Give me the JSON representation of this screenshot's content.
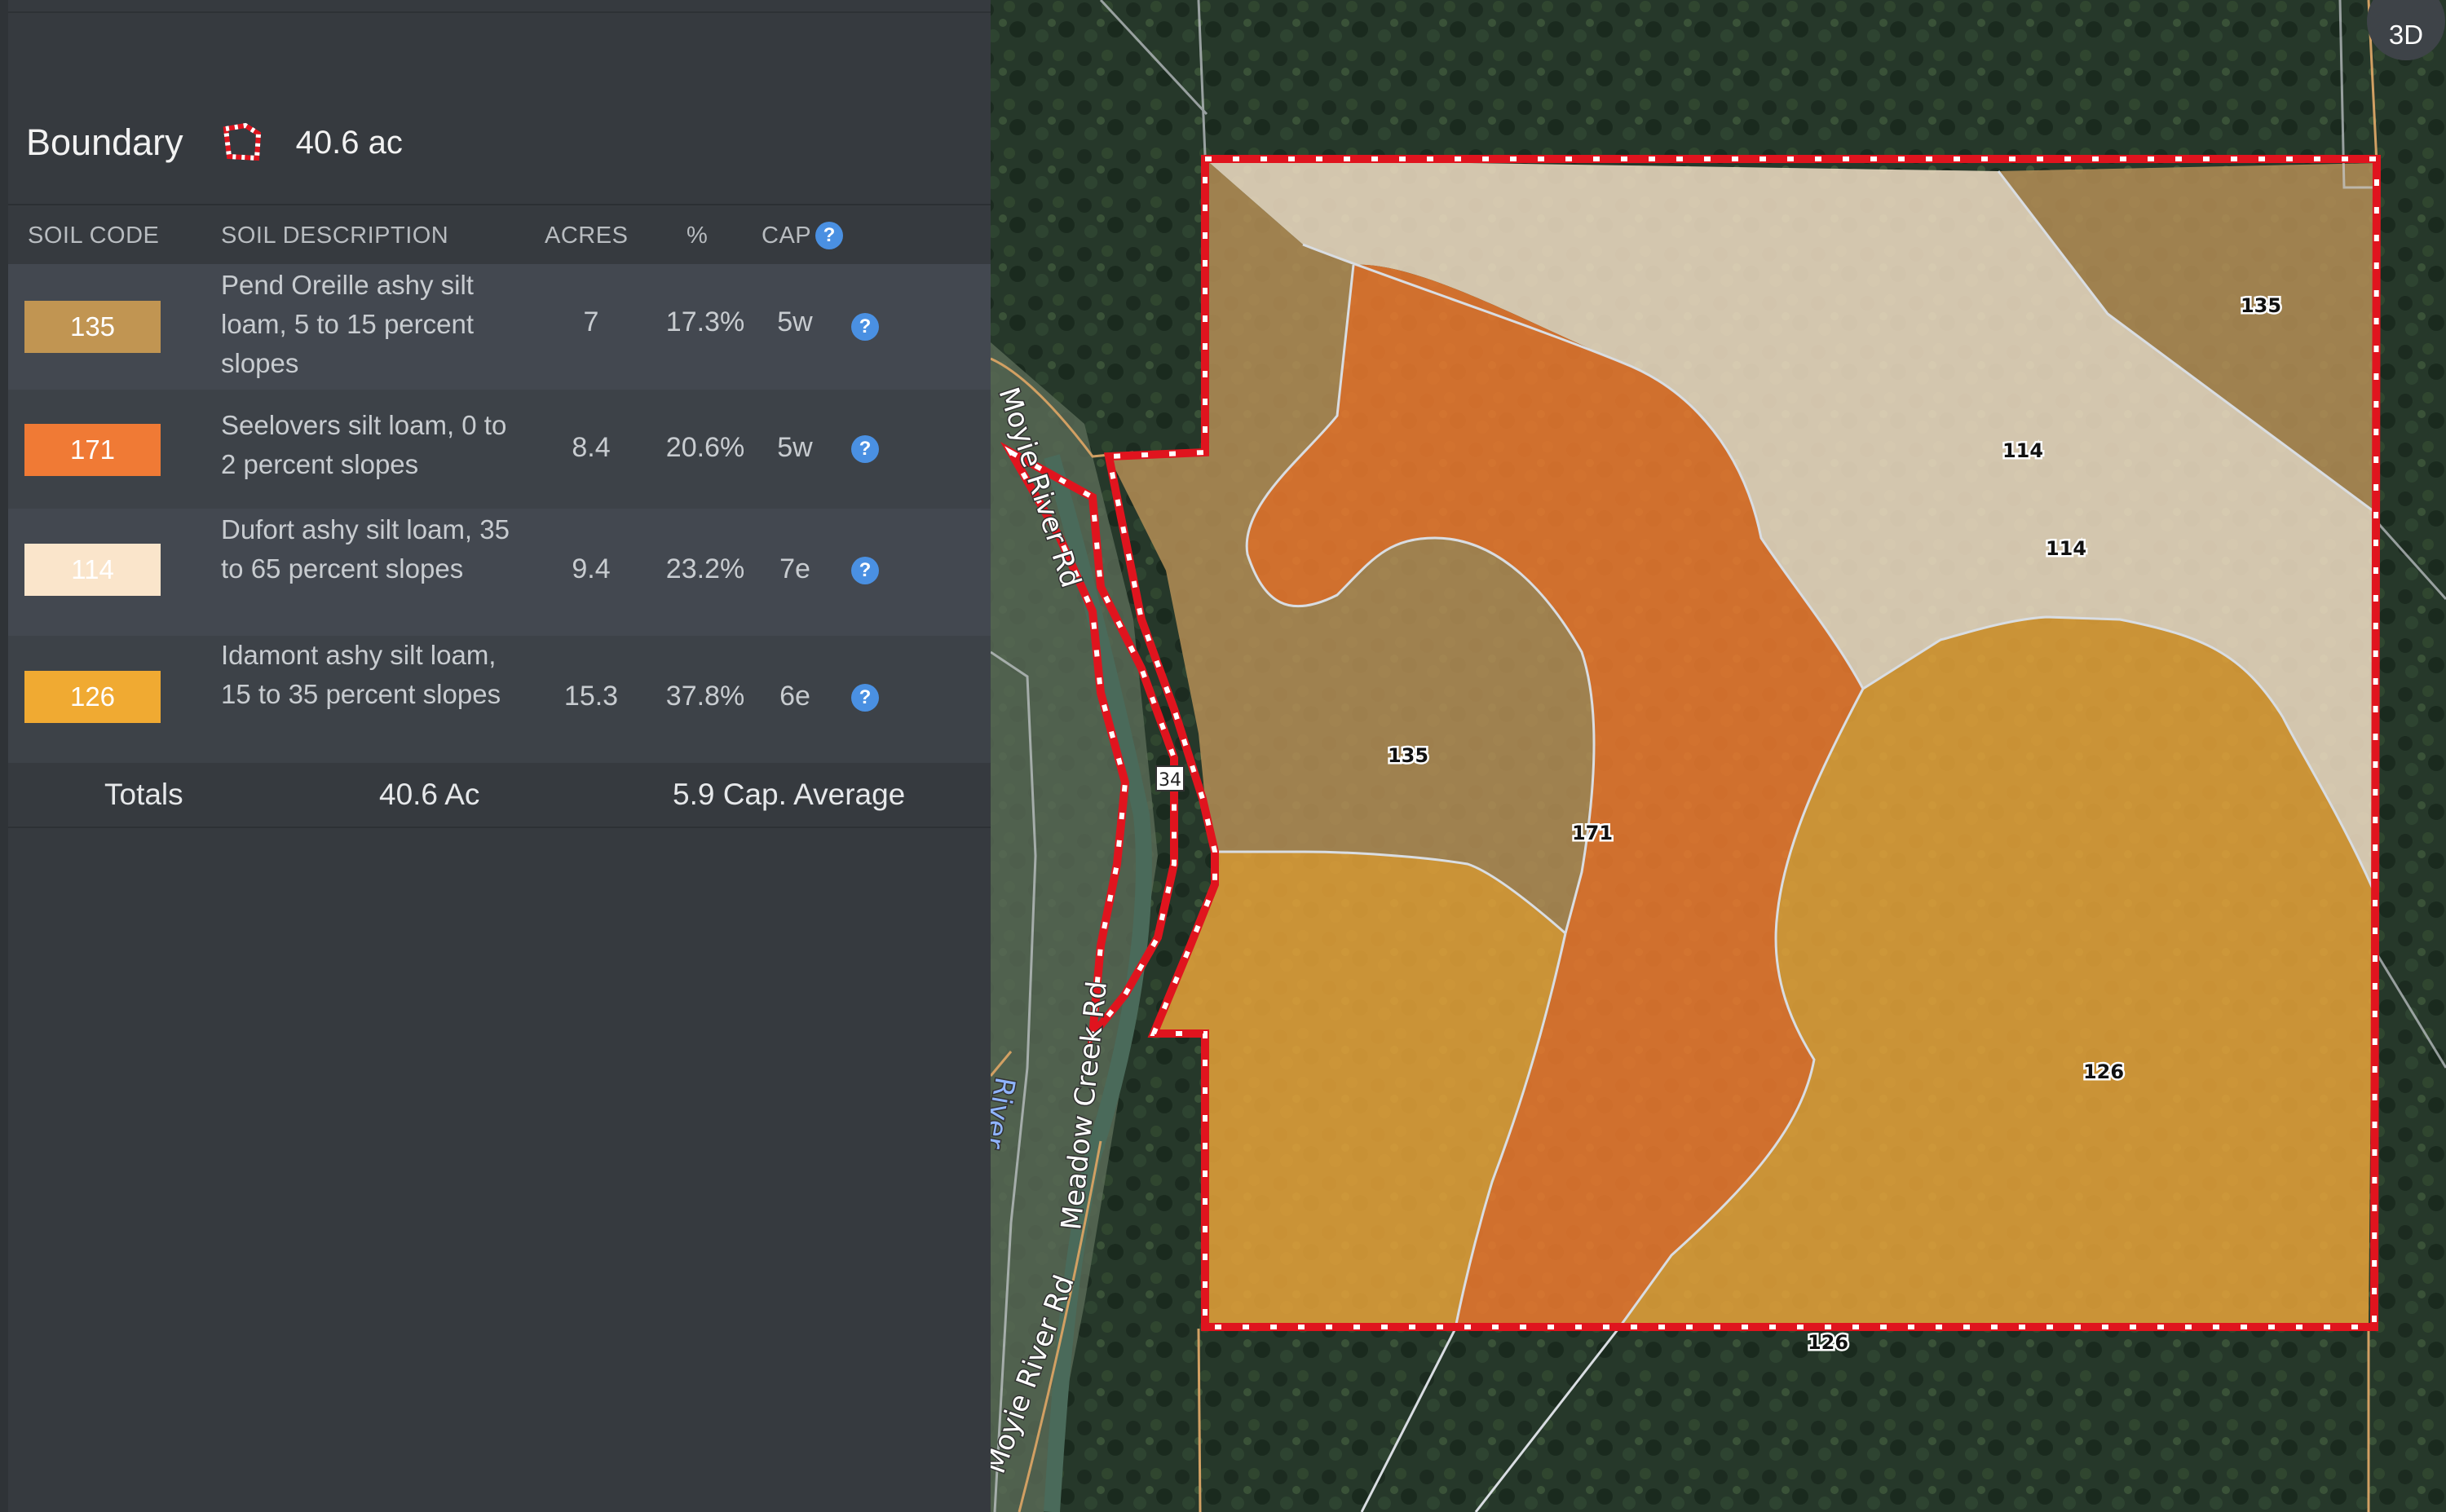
{
  "boundary": {
    "title": "Boundary",
    "acres": "40.6 ac"
  },
  "table": {
    "headers": {
      "soil_code": "SOIL CODE",
      "soil_description": "SOIL DESCRIPTION",
      "acres": "ACRES",
      "percent": "%",
      "cap": "CAP"
    },
    "rows": [
      {
        "code": "135",
        "description": "Pend Oreille ashy silt loam, 5 to 15 percent slopes",
        "acres": "7",
        "percent": "17.3%",
        "cap": "5w",
        "color": "#c19552",
        "text_color": "#ffffff"
      },
      {
        "code": "171",
        "description": "Seelovers silt loam, 0 to 2 percent slopes",
        "acres": "8.4",
        "percent": "20.6%",
        "cap": "5w",
        "color": "#f07a35",
        "text_color": "#ffffff"
      },
      {
        "code": "114",
        "description": "Dufort ashy silt loam, 35 to 65 percent slopes",
        "acres": "9.4",
        "percent": "23.2%",
        "cap": "7e",
        "color": "#fae5cb",
        "text_color": "#ffffff"
      },
      {
        "code": "126",
        "description": "Idamont ashy silt loam, 15 to 35 percent slopes",
        "acres": "15.3",
        "percent": "37.8%",
        "cap": "6e",
        "color": "#f0aa32",
        "text_color": "#ffffff"
      }
    ],
    "totals": {
      "label": "Totals",
      "acres": "40.6 Ac",
      "cap_average": "5.9 Cap. Average"
    }
  },
  "map": {
    "zone_labels": [
      "135",
      "114",
      "114",
      "135",
      "171",
      "126",
      "126"
    ],
    "road_labels": [
      "Moyie River Rd",
      "Meadow Creek Rd",
      "Moyie River Rd"
    ],
    "river_label": "River",
    "road_shield": "34",
    "button_3d": "3D",
    "boundary_color": "#e0141e",
    "zone_colors": {
      "135": "#c19552",
      "171": "#f07a35",
      "114": "#fae5cb",
      "126": "#f0aa32"
    }
  }
}
